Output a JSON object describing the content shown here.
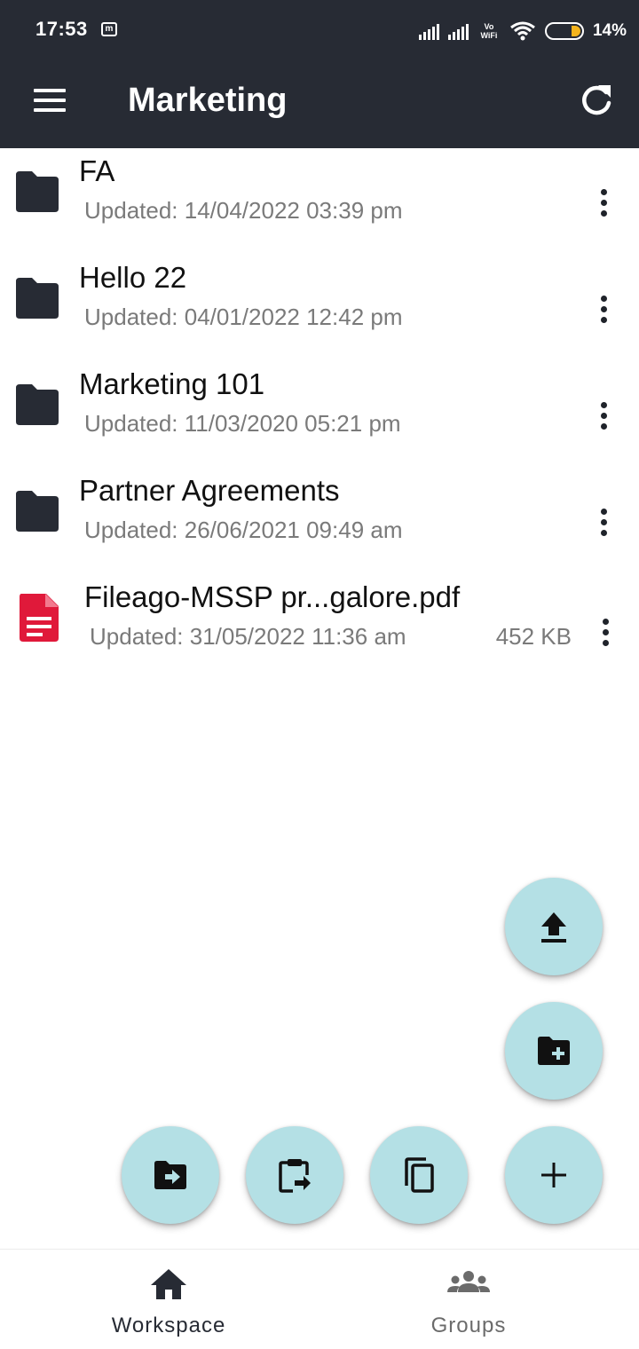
{
  "status_bar": {
    "time": "17:53",
    "notification_icon": "m",
    "vowifi": [
      "Vo",
      "WiFi"
    ],
    "battery_percent": "14%",
    "battery_level": 0.14
  },
  "app_bar": {
    "title": "Marketing",
    "menu_icon": "hamburger-menu-icon",
    "refresh_icon": "refresh-icon"
  },
  "items": [
    {
      "type": "folder",
      "name": "FA",
      "updated": "Updated: 14/04/2022 03:39 pm"
    },
    {
      "type": "folder",
      "name": "Hello 22",
      "updated": "Updated: 04/01/2022 12:42 pm"
    },
    {
      "type": "folder",
      "name": "Marketing 101",
      "updated": "Updated: 11/03/2020 05:21 pm"
    },
    {
      "type": "folder",
      "name": "Partner Agreements",
      "updated": "Updated: 26/06/2021 09:49 am"
    },
    {
      "type": "file",
      "name": "Fileago-MSSP pr...galore.pdf",
      "updated": "Updated: 31/05/2022 11:36 am",
      "size": "452 KB"
    }
  ],
  "fabs": [
    "upload-icon",
    "create-folder-icon",
    "move-to-folder-icon",
    "paste-icon",
    "copy-icon",
    "add-icon"
  ],
  "bottom_nav": {
    "workspace_label": "Workspace",
    "groups_label": "Groups"
  },
  "colors": {
    "app_bar": "#272b34",
    "fab": "#b4e0e5",
    "folder_icon": "#272b34",
    "pdf_icon": "#e0193a",
    "active_nav": "#272b34",
    "inactive_nav": "#6b6b6b",
    "battery": "#f3b31c"
  }
}
